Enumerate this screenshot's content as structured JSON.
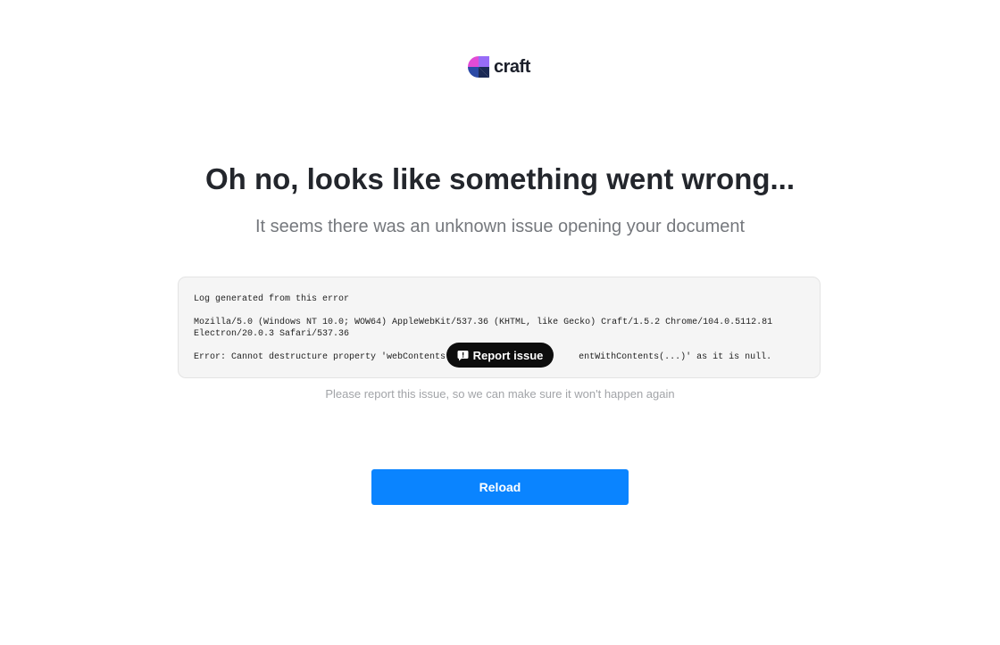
{
  "brand": {
    "name": "craft",
    "icon": "craft-logo-icon",
    "colors": [
      "#e24bd6",
      "#8c5cf6",
      "#2b4aa6",
      "#1b2a55"
    ]
  },
  "error": {
    "title": "Oh no, looks like something went wrong...",
    "subtitle": "It seems there was an unknown issue opening your document",
    "log": {
      "heading": "Log generated from this error",
      "user_agent": "Mozilla/5.0 (Windows NT 10.0; WOW64) AppleWebKit/537.36 (KHTML, like Gecko) Craft/1.5.2 Chrome/104.0.5112.81 Electron/20.0.3 Safari/537.36",
      "error_left": "Error: Cannot destructure property 'webContents' of",
      "error_right": "entWithContents(...)' as it is null."
    },
    "report_button": {
      "label": "Report issue",
      "icon": "feedback-icon"
    },
    "helper_text": "Please report this issue, so we can make sure it won't happen again",
    "reload_button": "Reload",
    "accent": "#0a84ff"
  }
}
